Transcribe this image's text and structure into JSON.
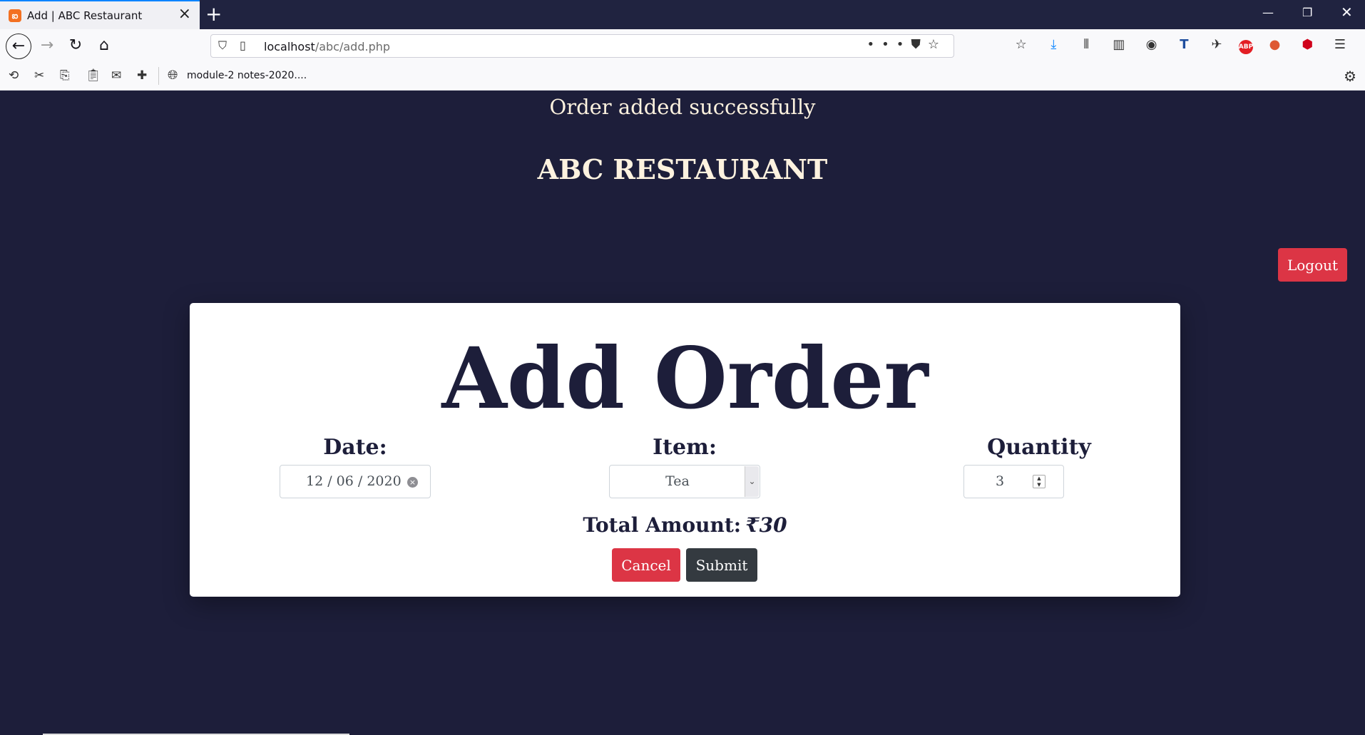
{
  "browser": {
    "tab_title": "Add | ABC Restaurant",
    "tab_favicon": "xampp-icon",
    "url_host": "localhost",
    "url_path": "/abc/add.php",
    "bookmark_label": "module-2 notes-2020...."
  },
  "page": {
    "flash_message": "Order added successfully",
    "restaurant_name": "ABC RESTAURANT",
    "logout_label": "Logout"
  },
  "form": {
    "title": "Add Order",
    "date_label": "Date:",
    "date_value": "12 / 06 / 2020",
    "item_label": "Item:",
    "item_value": "Tea",
    "quantity_label": "Quantity",
    "quantity_value": "3",
    "total_label": "Total Amount:",
    "total_value": "₹30",
    "cancel_label": "Cancel",
    "submit_label": "Submit"
  },
  "colors": {
    "background": "#1d1e3a",
    "heading_text": "#fdf2df",
    "danger": "#dc3545",
    "dark_button": "#343a40"
  }
}
